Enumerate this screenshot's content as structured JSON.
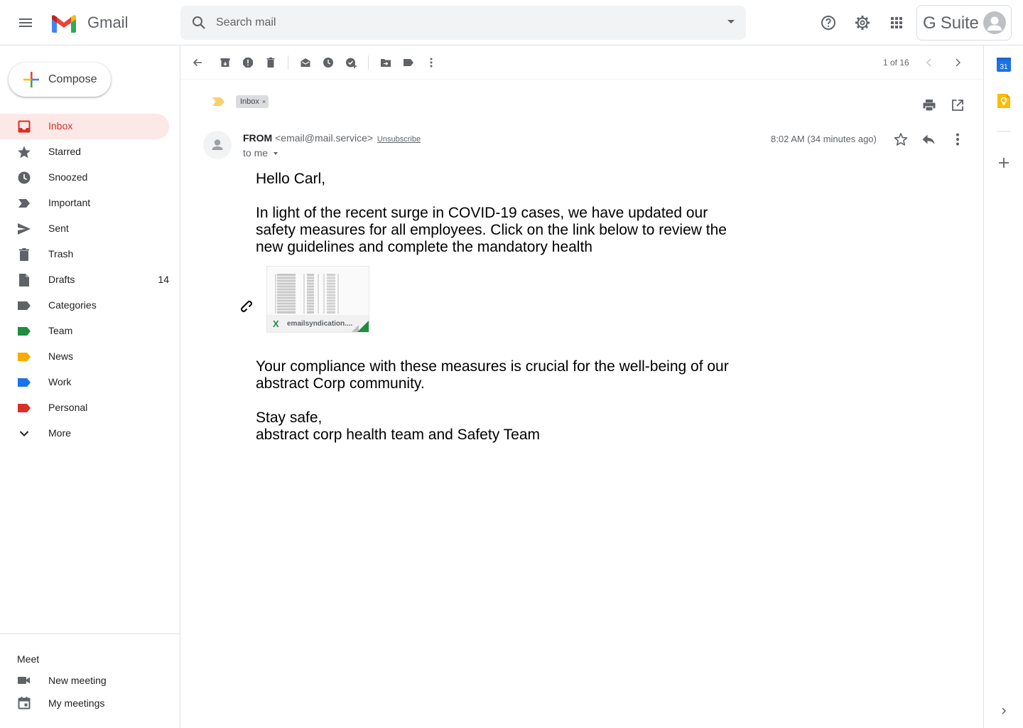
{
  "app": {
    "brand": "Gmail",
    "search_placeholder": "Search mail",
    "gsuite_label": "G Suite"
  },
  "sidebar": {
    "compose_label": "Compose",
    "items": [
      {
        "label": "Inbox",
        "count": "",
        "icon": "inbox-icon",
        "active": true
      },
      {
        "label": "Starred",
        "count": "",
        "icon": "star-icon"
      },
      {
        "label": "Snoozed",
        "count": "",
        "icon": "clock-icon"
      },
      {
        "label": "Important",
        "count": "",
        "icon": "important-icon"
      },
      {
        "label": "Sent",
        "count": "",
        "icon": "send-icon"
      },
      {
        "label": "Trash",
        "count": "",
        "icon": "trash-icon"
      },
      {
        "label": "Drafts",
        "count": "14",
        "icon": "draft-icon"
      },
      {
        "label": "Categories",
        "count": "",
        "icon": "label-icon",
        "color": "#5f6368"
      },
      {
        "label": "Team",
        "count": "",
        "icon": "label-icon",
        "color": "#1e8e3e"
      },
      {
        "label": "News",
        "count": "",
        "icon": "label-icon",
        "color": "#f9ab00"
      },
      {
        "label": "Work",
        "count": "",
        "icon": "label-icon",
        "color": "#1a73e8"
      },
      {
        "label": "Personal",
        "count": "",
        "icon": "label-icon",
        "color": "#d93025"
      },
      {
        "label": "More",
        "count": "",
        "icon": "chevron-down-icon"
      }
    ],
    "meet": {
      "title": "Meet",
      "new_meeting": "New meeting",
      "my_meetings": "My meetings"
    }
  },
  "toolbar": {
    "pager": "1 of 16"
  },
  "email": {
    "label_chip": "Inbox",
    "label_chip_close": "×",
    "sender_name": "FROM",
    "sender_email": "<email@mail.service>",
    "unsubscribe": "Unsubscribe",
    "to_line": "to me",
    "time": "8:02 AM (34 minutes ago)",
    "greeting": "Hello Carl,",
    "paragraph1": "In light of the recent surge in COVID-19 cases, we have updated our safety measures for all employees. Click on the link below to review the new guidelines and complete the mandatory health",
    "attachment_name": "emailsyndication....",
    "attachment_type_icon": "X",
    "paragraph2": "Your compliance with these measures is crucial for the well-being of our abstract Corp community.",
    "signoff": "Stay safe,",
    "signature": "abstract corp health team and Safety Team"
  },
  "side_panel": {
    "calendar_day": "31"
  },
  "colors": {
    "accent_red": "#d93025",
    "active_bg": "#fce8e6",
    "important_yellow": "#f9d06d"
  }
}
